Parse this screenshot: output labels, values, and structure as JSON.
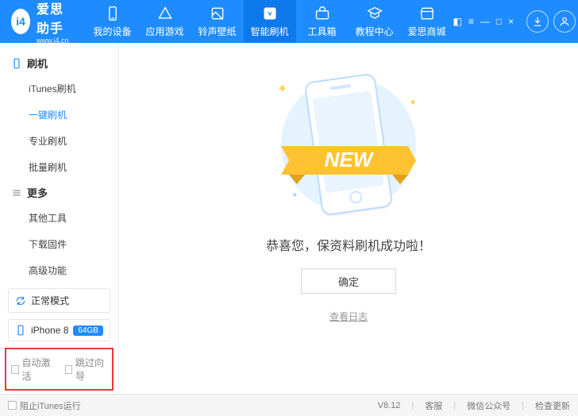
{
  "app": {
    "name": "爱思助手",
    "site": "www.i4.cn",
    "logo_letters": "i4"
  },
  "nav": {
    "items": [
      {
        "label": "我的设备"
      },
      {
        "label": "应用游戏"
      },
      {
        "label": "铃声壁纸"
      },
      {
        "label": "智能刷机"
      },
      {
        "label": "工具箱"
      },
      {
        "label": "教程中心"
      },
      {
        "label": "爱思商城"
      }
    ]
  },
  "sidebar": {
    "group1": {
      "title": "刷机",
      "items": [
        "iTunes刷机",
        "一键刷机",
        "专业刷机",
        "批量刷机"
      ]
    },
    "group2": {
      "title": "更多",
      "items": [
        "其他工具",
        "下载固件",
        "高级功能"
      ]
    },
    "mode": "正常模式",
    "device": {
      "name": "iPhone 8",
      "storage": "64GB"
    },
    "auto_activate": "自动激活",
    "skip_guide": "跳过向导"
  },
  "main": {
    "ribbon_text": "NEW",
    "success": "恭喜您，保资料刷机成功啦！",
    "ok": "确定",
    "log": "查看日志"
  },
  "footer": {
    "block_itunes": "阻止iTunes运行",
    "version": "V8.12",
    "support": "客服",
    "wechat": "微信公众号",
    "update": "检查更新"
  }
}
